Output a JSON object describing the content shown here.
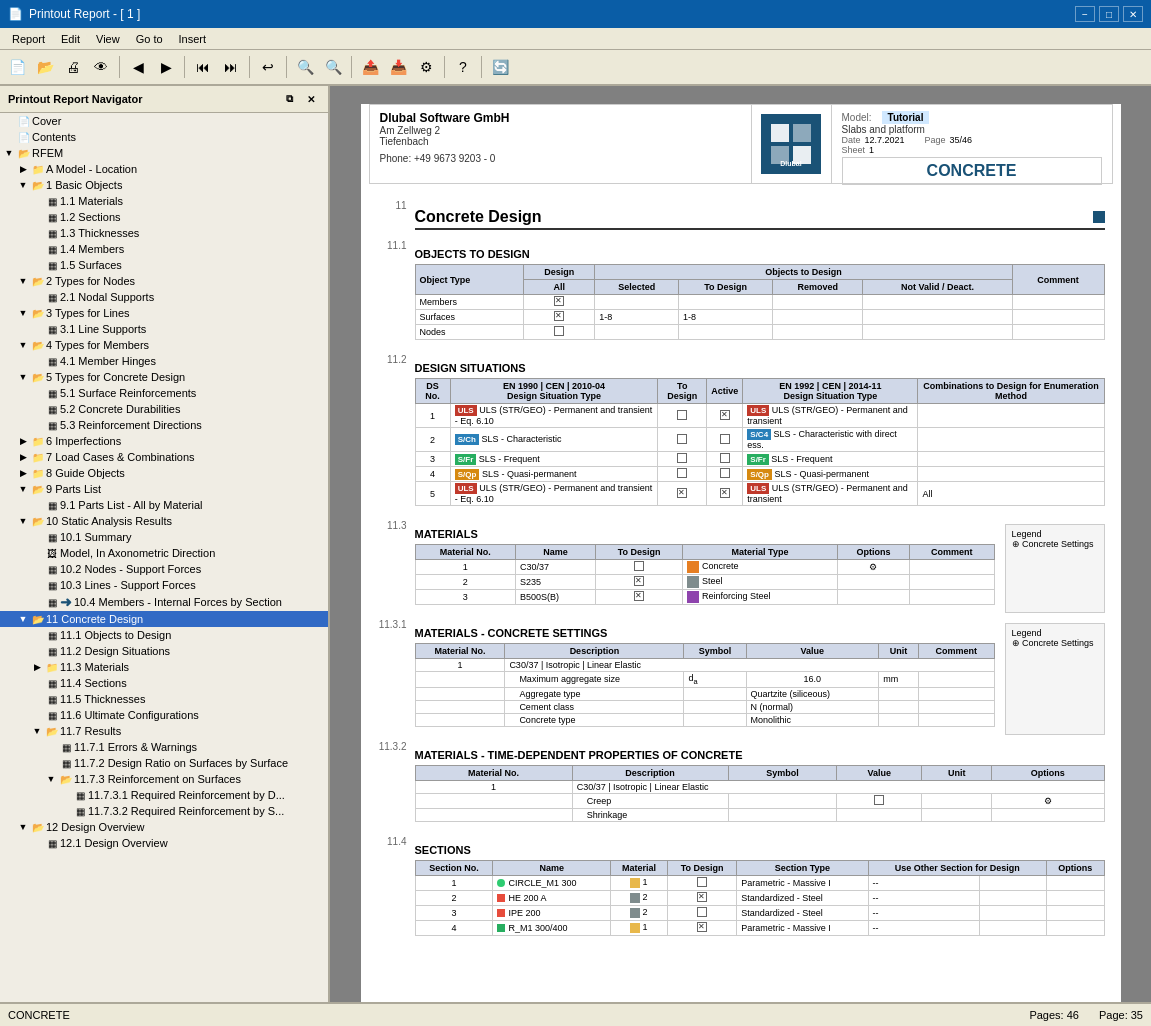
{
  "titlebar": {
    "title": "Printout Report - [ 1 ]",
    "icon": "📄",
    "min_label": "−",
    "max_label": "□",
    "close_label": "✕"
  },
  "menubar": {
    "items": [
      "Report",
      "Edit",
      "View",
      "Go to",
      "Insert"
    ]
  },
  "navigator": {
    "title": "Printout Report Navigator",
    "tree": [
      {
        "id": "cover",
        "label": "Cover",
        "level": 0,
        "type": "page",
        "expanded": false
      },
      {
        "id": "contents",
        "label": "Contents",
        "level": 0,
        "type": "page",
        "expanded": false
      },
      {
        "id": "rfem",
        "label": "RFEM",
        "level": 0,
        "type": "folder",
        "expanded": true
      },
      {
        "id": "a-model",
        "label": "A Model - Location",
        "level": 1,
        "type": "folder",
        "expanded": false
      },
      {
        "id": "1-basic",
        "label": "1 Basic Objects",
        "level": 1,
        "type": "folder",
        "expanded": true
      },
      {
        "id": "1-1",
        "label": "1.1 Materials",
        "level": 2,
        "type": "grid"
      },
      {
        "id": "1-2",
        "label": "1.2 Sections",
        "level": 2,
        "type": "grid"
      },
      {
        "id": "1-3",
        "label": "1.3 Thicknesses",
        "level": 2,
        "type": "grid"
      },
      {
        "id": "1-4",
        "label": "1.4 Members",
        "level": 2,
        "type": "grid"
      },
      {
        "id": "1-5",
        "label": "1.5 Surfaces",
        "level": 2,
        "type": "grid"
      },
      {
        "id": "2-nodes",
        "label": "2 Types for Nodes",
        "level": 1,
        "type": "folder",
        "expanded": true
      },
      {
        "id": "2-1",
        "label": "2.1 Nodal Supports",
        "level": 2,
        "type": "grid"
      },
      {
        "id": "3-lines",
        "label": "3 Types for Lines",
        "level": 1,
        "type": "folder",
        "expanded": true
      },
      {
        "id": "3-1",
        "label": "3.1 Line Supports",
        "level": 2,
        "type": "grid"
      },
      {
        "id": "4-members",
        "label": "4 Types for Members",
        "level": 1,
        "type": "folder",
        "expanded": true
      },
      {
        "id": "4-1",
        "label": "4.1 Member Hinges",
        "level": 2,
        "type": "grid"
      },
      {
        "id": "5-concrete",
        "label": "5 Types for Concrete Design",
        "level": 1,
        "type": "folder",
        "expanded": true
      },
      {
        "id": "5-1",
        "label": "5.1 Surface Reinforcements",
        "level": 2,
        "type": "grid"
      },
      {
        "id": "5-2",
        "label": "5.2 Concrete Durabilities",
        "level": 2,
        "type": "grid"
      },
      {
        "id": "5-3",
        "label": "5.3 Reinforcement Directions",
        "level": 2,
        "type": "grid"
      },
      {
        "id": "6-imp",
        "label": "6 Imperfections",
        "level": 1,
        "type": "folder",
        "expanded": false
      },
      {
        "id": "7-load",
        "label": "7 Load Cases & Combinations",
        "level": 1,
        "type": "folder",
        "expanded": false
      },
      {
        "id": "8-guide",
        "label": "8 Guide Objects",
        "level": 1,
        "type": "folder",
        "expanded": false
      },
      {
        "id": "9-parts",
        "label": "9 Parts List",
        "level": 1,
        "type": "folder",
        "expanded": true
      },
      {
        "id": "9-1",
        "label": "9.1 Parts List - All by Material",
        "level": 2,
        "type": "grid"
      },
      {
        "id": "10-static",
        "label": "10 Static Analysis Results",
        "level": 1,
        "type": "folder",
        "expanded": true
      },
      {
        "id": "10-1",
        "label": "10.1 Summary",
        "level": 2,
        "type": "grid"
      },
      {
        "id": "10-model",
        "label": "Model, In Axonometric Direction",
        "level": 2,
        "type": "image"
      },
      {
        "id": "10-2",
        "label": "10.2 Nodes - Support Forces",
        "level": 2,
        "type": "grid"
      },
      {
        "id": "10-3",
        "label": "10.3 Lines - Support Forces",
        "level": 2,
        "type": "grid"
      },
      {
        "id": "10-4",
        "label": "10.4 Members - Internal Forces by Section",
        "level": 2,
        "type": "grid"
      },
      {
        "id": "11-concrete",
        "label": "11 Concrete Design",
        "level": 1,
        "type": "folder",
        "expanded": true,
        "selected": true
      },
      {
        "id": "11-1",
        "label": "11.1 Objects to Design",
        "level": 2,
        "type": "grid"
      },
      {
        "id": "11-2",
        "label": "11.2 Design Situations",
        "level": 2,
        "type": "grid"
      },
      {
        "id": "11-3",
        "label": "11.3 Materials",
        "level": 2,
        "type": "folder",
        "expanded": false
      },
      {
        "id": "11-4",
        "label": "11.4 Sections",
        "level": 2,
        "type": "grid"
      },
      {
        "id": "11-5",
        "label": "11.5 Thicknesses",
        "level": 2,
        "type": "grid"
      },
      {
        "id": "11-6",
        "label": "11.6 Ultimate Configurations",
        "level": 2,
        "type": "grid"
      },
      {
        "id": "11-7",
        "label": "11.7 Results",
        "level": 2,
        "type": "folder",
        "expanded": true
      },
      {
        "id": "11-7-1",
        "label": "11.7.1 Errors & Warnings",
        "level": 3,
        "type": "grid"
      },
      {
        "id": "11-7-2",
        "label": "11.7.2 Design Ratio on Surfaces by Surface",
        "level": 3,
        "type": "grid"
      },
      {
        "id": "11-7-3",
        "label": "11.7.3 Reinforcement on Surfaces",
        "level": 3,
        "type": "folder",
        "expanded": true
      },
      {
        "id": "11-7-3-1",
        "label": "11.7.3.1 Required Reinforcement by D...",
        "level": 4,
        "type": "grid"
      },
      {
        "id": "11-7-3-2",
        "label": "11.7.3.2 Required Reinforcement by S...",
        "level": 4,
        "type": "grid"
      },
      {
        "id": "12-design",
        "label": "12 Design Overview",
        "level": 1,
        "type": "folder",
        "expanded": true
      },
      {
        "id": "12-1",
        "label": "12.1 Design Overview",
        "level": 2,
        "type": "grid"
      }
    ]
  },
  "page": {
    "header": {
      "company": "Dlubal Software GmbH",
      "address1": "Am Zellweg 2",
      "address2": "Tiefenbach",
      "phone": "Phone: +49 9673 9203 - 0",
      "model_label": "Model:",
      "model_value": "Tutorial",
      "subtitle": "Slabs and platform",
      "date_label": "Date",
      "date_value": "12.7.2021",
      "page_label": "Page",
      "page_value": "35/46",
      "sheet_label": "Sheet",
      "sheet_value": "1",
      "title": "CONCRETE"
    },
    "section_number": "11",
    "section_title": "Concrete Design",
    "subsections": [
      {
        "id": "11.1",
        "number": "11.1",
        "title": "OBJECTS TO DESIGN",
        "table": {
          "headers_row1": [
            "",
            "Design",
            "Objects to Design",
            "",
            "",
            "",
            ""
          ],
          "headers_row2": [
            "Object Type",
            "All",
            "Selected",
            "To Design",
            "Removed",
            "Not Valid / Deact.",
            "Comment"
          ],
          "rows": [
            [
              "Members",
              "☑",
              "",
              "",
              "",
              "",
              ""
            ],
            [
              "Surfaces",
              "☒",
              "1-8",
              "1-8",
              "",
              "",
              ""
            ],
            [
              "Nodes",
              "☐",
              "",
              "",
              "",
              "",
              ""
            ]
          ]
        }
      },
      {
        "id": "11.2",
        "number": "11.2",
        "title": "DESIGN SITUATIONS",
        "table": {
          "headers": [
            "DS No.",
            "EN 1990 | CEN | 2010-04 Design Situation Type",
            "To Design",
            "Active",
            "EN 1992 | CEN | 2014-11 Design Situation Type",
            "Combinations to Design for Enumeration Method"
          ],
          "rows": [
            {
              "no": "1",
              "type1_tag": "ULS",
              "type1_color": "red",
              "type1_text": "ULS (STR/GEO) - Permanent and transient - Eq. 6.10",
              "to_design": "☐",
              "active": "☑",
              "type2_tag": "ULS",
              "type2_color": "red",
              "type2_text": "ULS (STR/GEO) - Permanent and transient",
              "combinations": ""
            },
            {
              "no": "2",
              "type1_tag": "S/Ch",
              "type1_color": "blue",
              "type1_text": "SLS - Characteristic",
              "to_design": "☐",
              "active": "☐",
              "type2_tag": "S/C4",
              "type2_color": "blue",
              "type2_text": "SLS - Characteristic with direct ess.",
              "combinations": ""
            },
            {
              "no": "3",
              "type1_tag": "S/Fr",
              "type1_color": "green",
              "type1_text": "SLS - Frequent",
              "to_design": "☐",
              "active": "☐",
              "type2_tag": "S/Fr",
              "type2_color": "green",
              "type2_text": "SLS - Frequent",
              "combinations": ""
            },
            {
              "no": "4",
              "type1_tag": "S/Qp",
              "type1_color": "orange",
              "type1_text": "SLS - Quasi-permanent",
              "to_design": "☐",
              "active": "☐",
              "type2_tag": "S/Qp",
              "type2_color": "orange",
              "type2_text": "SLS - Quasi-permanent",
              "combinations": ""
            },
            {
              "no": "5",
              "type1_tag": "ULS",
              "type1_color": "red",
              "type1_text": "ULS (STR/GEO) - Permanent and transient - Eq. 6.10",
              "to_design": "☑",
              "active": "☑",
              "type2_tag": "ULS",
              "type2_color": "red",
              "type2_text": "ULS (STR/GEO) - Permanent and transient",
              "combinations": "All"
            }
          ]
        }
      },
      {
        "id": "11.3",
        "number": "11.3",
        "title": "MATERIALS",
        "legend": "Legend\n⊕ Concrete Settings",
        "table": {
          "headers": [
            "Material No.",
            "Name",
            "To Design",
            "Material Type",
            "Options",
            "Comment"
          ],
          "rows": [
            {
              "no": "1",
              "name": "C30/37",
              "to_design": "☐",
              "type_color": "#e67e22",
              "type": "Concrete",
              "options": "⚙"
            },
            {
              "no": "2",
              "name": "S235",
              "to_design": "☑",
              "type_color": "#7f8c8d",
              "type": "Steel",
              "options": ""
            },
            {
              "no": "3",
              "name": "B500S(B)",
              "to_design": "☑",
              "type_color": "#8e44ad",
              "type": "Reinforcing Steel",
              "options": ""
            }
          ]
        }
      },
      {
        "id": "11.3.1",
        "number": "11.3.1",
        "title": "MATERIALS - CONCRETE SETTINGS",
        "legend": "Legend\n⊕ Concrete Settings",
        "table": {
          "headers": [
            "Material No.",
            "Description",
            "Symbol",
            "Value",
            "Unit",
            "Comment"
          ],
          "rows": [
            {
              "no": "1",
              "desc": "C30/37 | Isotropic | Linear Elastic",
              "sym": "",
              "val": "",
              "unit": "",
              "comment": ""
            },
            {
              "no": "",
              "desc": "Maximum aggregate size",
              "sym": "d_a",
              "val": "16.0",
              "unit": "mm",
              "comment": ""
            },
            {
              "no": "",
              "desc": "Aggregate type",
              "sym": "",
              "val": "Quartzite (siliceous)",
              "unit": "",
              "comment": ""
            },
            {
              "no": "",
              "desc": "Cement class",
              "sym": "",
              "val": "N (normal)",
              "unit": "",
              "comment": ""
            },
            {
              "no": "",
              "desc": "Concrete type",
              "sym": "",
              "val": "Monolithic",
              "unit": "",
              "comment": ""
            }
          ]
        }
      },
      {
        "id": "11.3.2",
        "number": "11.3.2",
        "title": "MATERIALS - TIME-DEPENDENT PROPERTIES OF CONCRETE",
        "table": {
          "headers": [
            "Material No.",
            "Description",
            "Symbol",
            "Value",
            "Unit",
            "Options"
          ],
          "rows": [
            {
              "no": "1",
              "desc": "C30/37 | Isotropic | Linear Elastic",
              "sym": "",
              "val": "",
              "unit": "",
              "opt": ""
            },
            {
              "no": "",
              "desc": "Creep",
              "sym": "",
              "val": "☐",
              "unit": "",
              "opt": "⚙"
            },
            {
              "no": "",
              "desc": "Shrinkage",
              "sym": "",
              "val": "",
              "unit": "",
              "opt": ""
            }
          ]
        }
      },
      {
        "id": "11.4",
        "number": "11.4",
        "title": "SECTIONS",
        "table": {
          "headers": [
            "Section No.",
            "Name",
            "Material",
            "To Design",
            "Section Type",
            "Use Other Section for Design",
            "Options"
          ],
          "rows": [
            {
              "no": "1",
              "dot_color": "#2ecc71",
              "name": "CIRCLE_M1 300",
              "mat_color": "#e8b84b",
              "mat": "1",
              "to_design": "☐",
              "type": "Parametric - Massive I",
              "other": "--",
              "opt": ""
            },
            {
              "no": "2",
              "dot_color": "#e74c3c",
              "name": "HE 200 A",
              "mat_color": "#7f8c8d",
              "mat": "2",
              "to_design": "☑",
              "type": "Standardized - Steel",
              "other": "--",
              "opt": ""
            },
            {
              "no": "3",
              "dot_color": "#e74c3c",
              "name": "IPE 200",
              "mat_color": "#7f8c8d",
              "mat": "2",
              "to_design": "☐",
              "type": "Standardized - Steel",
              "other": "--",
              "opt": ""
            },
            {
              "no": "4",
              "dot_color": "#2ecc71",
              "name": "R_M1 300/400",
              "mat_color": "#e8b84b",
              "mat": "1",
              "to_design": "☑",
              "type": "Parametric - Massive I",
              "other": "--",
              "opt": ""
            }
          ]
        }
      }
    ]
  },
  "statusbar": {
    "module": "CONCRETE",
    "pages_label": "Pages:",
    "pages_value": "46",
    "page_label": "Page:",
    "page_value": "35"
  }
}
